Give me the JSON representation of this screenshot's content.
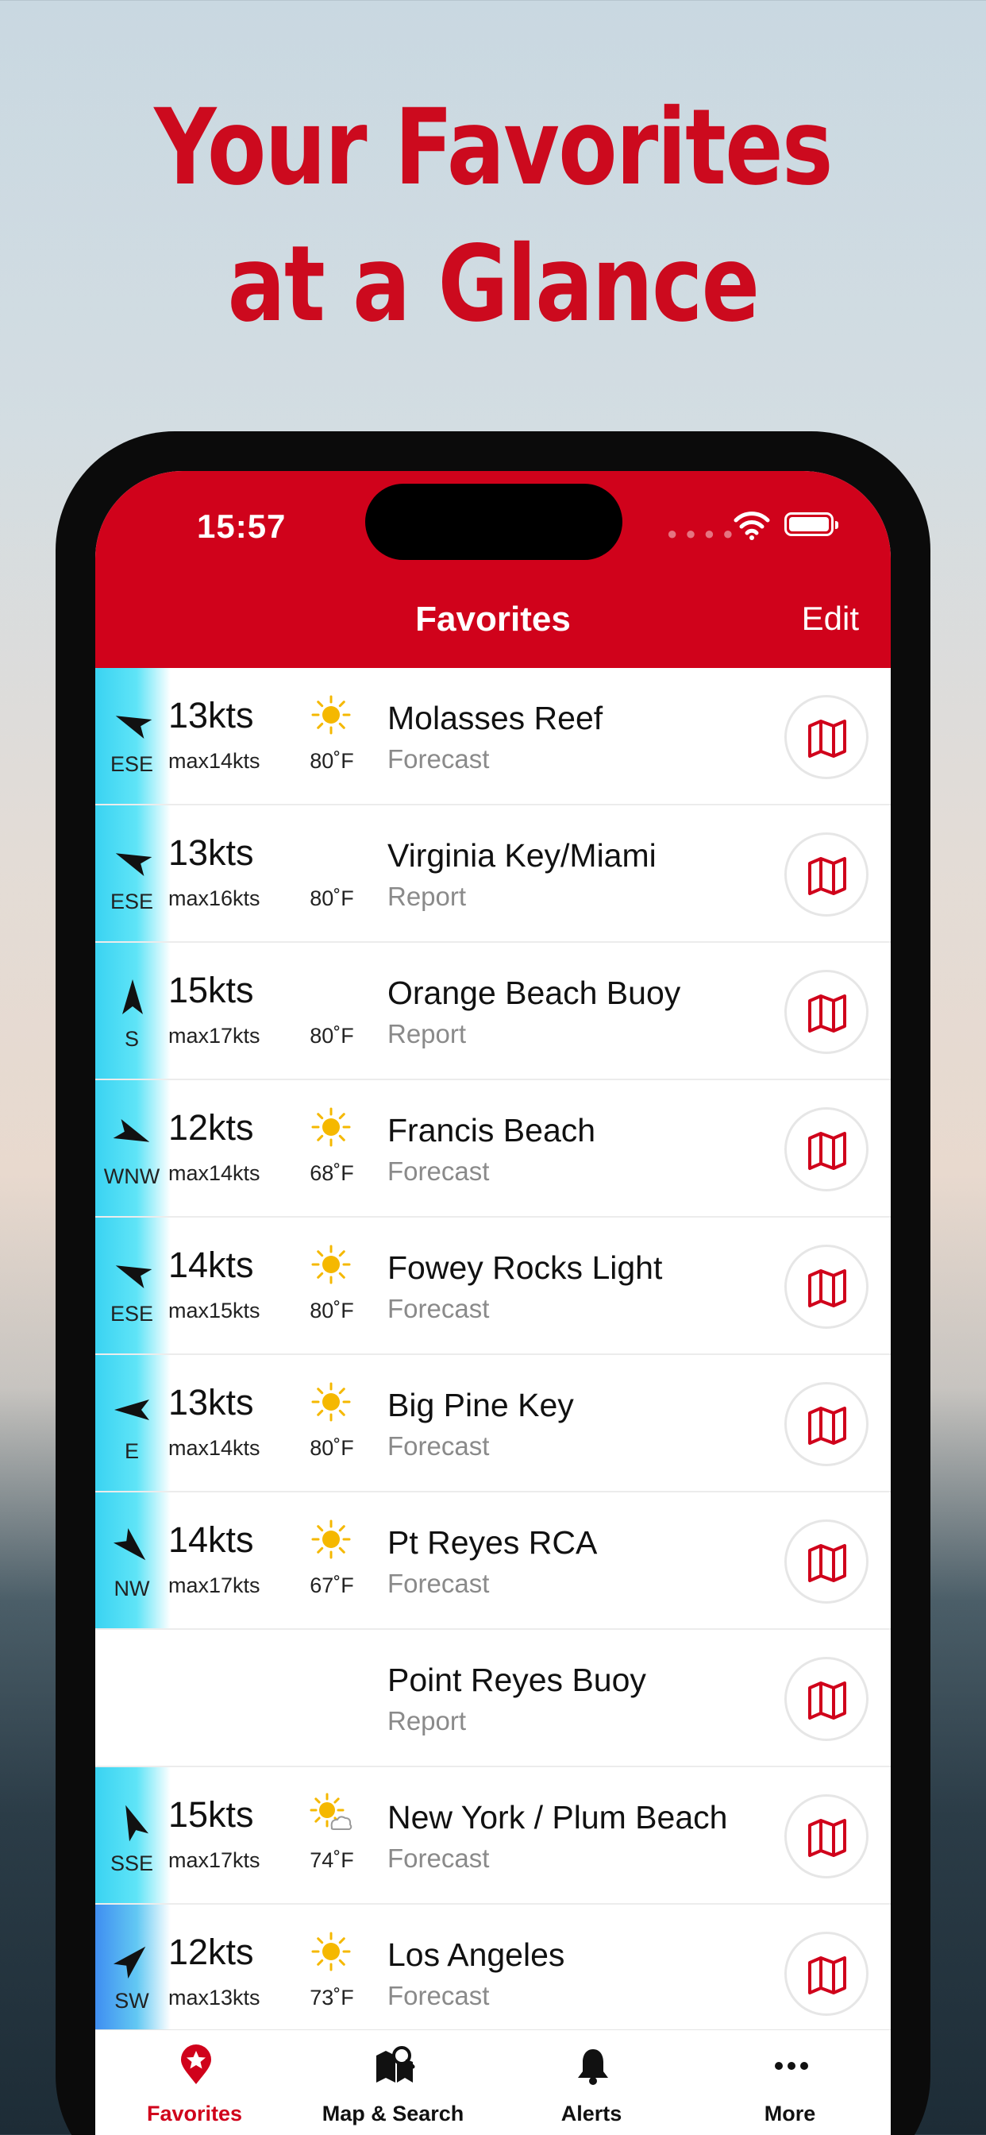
{
  "headline": {
    "line1": "Your Favorites",
    "line2": "at a Glance"
  },
  "status_bar": {
    "time": "15:57"
  },
  "nav": {
    "title": "Favorites",
    "edit_label": "Edit"
  },
  "favorites": [
    {
      "dir": "ESE",
      "bearing": 292.5,
      "wind": "13kts",
      "max": "max14kts",
      "weather_icon": "sun-icon",
      "temp": "80˚F",
      "name": "Molasses Reef",
      "type": "Forecast",
      "bar": "cyan"
    },
    {
      "dir": "ESE",
      "bearing": 292.5,
      "wind": "13kts",
      "max": "max16kts",
      "weather_icon": "",
      "temp": "80˚F",
      "name": "Virginia Key/Miami",
      "type": "Report",
      "bar": "cyan"
    },
    {
      "dir": "S",
      "bearing": 0,
      "wind": "15kts",
      "max": "max17kts",
      "weather_icon": "",
      "temp": "80˚F",
      "name": "Orange Beach Buoy",
      "type": "Report",
      "bar": "cyan"
    },
    {
      "dir": "WNW",
      "bearing": 112.5,
      "wind": "12kts",
      "max": "max14kts",
      "weather_icon": "sun-icon",
      "temp": "68˚F",
      "name": "Francis Beach",
      "type": "Forecast",
      "bar": "cyan"
    },
    {
      "dir": "ESE",
      "bearing": 292.5,
      "wind": "14kts",
      "max": "max15kts",
      "weather_icon": "sun-icon",
      "temp": "80˚F",
      "name": "Fowey Rocks Light",
      "type": "Forecast",
      "bar": "cyan"
    },
    {
      "dir": "E",
      "bearing": 270,
      "wind": "13kts",
      "max": "max14kts",
      "weather_icon": "sun-icon",
      "temp": "80˚F",
      "name": "Big Pine Key",
      "type": "Forecast",
      "bar": "cyan"
    },
    {
      "dir": "NW",
      "bearing": 135,
      "wind": "14kts",
      "max": "max17kts",
      "weather_icon": "sun-icon",
      "temp": "67˚F",
      "name": "Pt Reyes RCA",
      "type": "Forecast",
      "bar": "cyan"
    },
    {
      "dir": "",
      "bearing": null,
      "wind": "",
      "max": "",
      "weather_icon": "",
      "temp": "",
      "name": "Point Reyes Buoy",
      "type": "Report",
      "bar": "none"
    },
    {
      "dir": "SSE",
      "bearing": 337.5,
      "wind": "15kts",
      "max": "max17kts",
      "weather_icon": "sun-cloud-icon",
      "temp": "74˚F",
      "name": "New York / Plum Beach",
      "type": "Forecast",
      "bar": "cyan"
    },
    {
      "dir": "SW",
      "bearing": 45,
      "wind": "12kts",
      "max": "max13kts",
      "weather_icon": "sun-icon",
      "temp": "73˚F",
      "name": "Los Angeles",
      "type": "Forecast",
      "bar": "blue"
    }
  ],
  "tabs": [
    {
      "label": "Favorites",
      "icon": "star-pin-icon",
      "active": true
    },
    {
      "label": "Map & Search",
      "icon": "map-search-icon",
      "active": false
    },
    {
      "label": "Alerts",
      "icon": "bell-icon",
      "active": false
    },
    {
      "label": "More",
      "icon": "more-dots-icon",
      "active": false
    }
  ],
  "colors": {
    "brand_red": "#d0021b",
    "headline_red": "#cc0a1e",
    "wind_bar_cyan": "#3ad3f2",
    "wind_bar_blue": "#3f8ef1",
    "sun_yellow": "#f5b800"
  }
}
